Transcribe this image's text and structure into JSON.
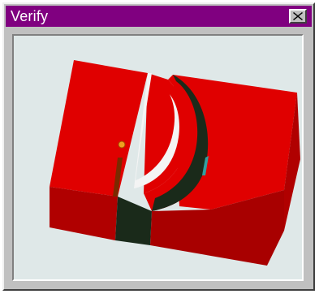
{
  "window": {
    "title": "Verify",
    "close_icon": "close-icon"
  },
  "viewport": {
    "background_color": "#dfe8e8",
    "model_color": "#e00000",
    "model_shadow_color": "#a00000",
    "cut_color": "#1a2a1a",
    "icons": [
      "verify-model",
      "tool-marker-icon"
    ]
  }
}
